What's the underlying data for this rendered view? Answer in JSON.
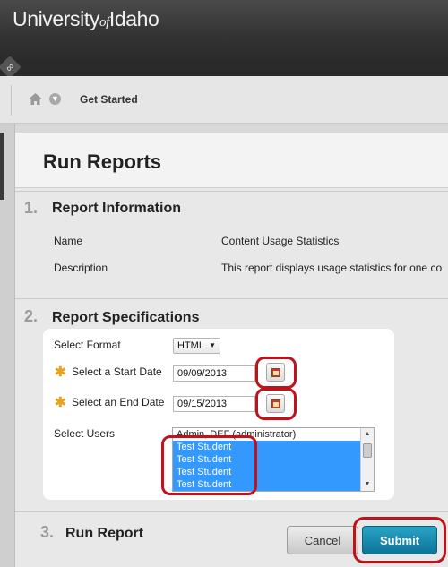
{
  "header": {
    "brand_part1": "University",
    "brand_of": "of",
    "brand_part2": "Idaho"
  },
  "breadcrumb": {
    "current": "Get Started"
  },
  "page": {
    "title": "Run Reports"
  },
  "sections": {
    "report_info": {
      "number": "1.",
      "title": "Report Information",
      "name_label": "Name",
      "name_value": "Content Usage Statistics",
      "description_label": "Description",
      "description_value": "This report displays usage statistics for one co"
    },
    "report_specs": {
      "number": "2.",
      "title": "Report Specifications",
      "format_label": "Select Format",
      "format_value": "HTML",
      "start_label": "Select a Start Date",
      "start_value": "09/09/2013",
      "end_label": "Select an End Date",
      "end_value": "09/15/2013",
      "users_label": "Select Users",
      "users": [
        "Admin, DEF (administrator)",
        "Test Student",
        "Test Student",
        "Test Student",
        "Test Student"
      ],
      "required_mark": "✱"
    },
    "run_report": {
      "number": "3.",
      "title": "Run Report"
    }
  },
  "actions": {
    "cancel_label": "Cancel",
    "submit_label": "Submit"
  },
  "colors": {
    "highlight_ring": "#c0121b",
    "selection": "#3399ff",
    "submit": "#0c7596"
  }
}
